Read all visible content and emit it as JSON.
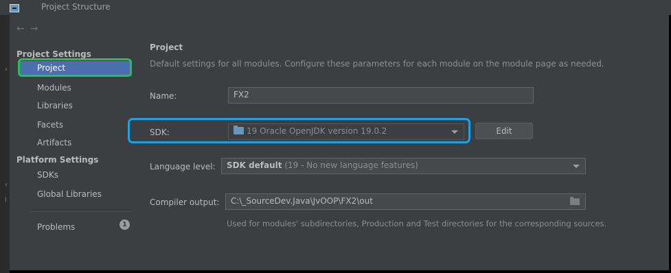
{
  "window": {
    "title": "Project Structure"
  },
  "nav": {
    "back": "←",
    "forward": "→"
  },
  "sidebar": {
    "project_settings_header": "Project Settings",
    "project_settings_items": [
      {
        "label": "Project",
        "selected": true
      },
      {
        "label": "Modules"
      },
      {
        "label": "Libraries"
      },
      {
        "label": "Facets"
      },
      {
        "label": "Artifacts"
      }
    ],
    "platform_settings_header": "Platform Settings",
    "platform_settings_items": [
      {
        "label": "SDKs"
      },
      {
        "label": "Global Libraries"
      }
    ],
    "problems": {
      "label": "Problems",
      "count": "1"
    }
  },
  "main": {
    "title": "Project",
    "description": "Default settings for all modules. Configure these parameters for each module on the module page as needed.",
    "name": {
      "label": "Name:",
      "value": "FX2"
    },
    "sdk": {
      "label": "SDK:",
      "version": "19",
      "detail": "Oracle OpenJDK version 19.0.2",
      "edit_label": "Edit"
    },
    "language_level": {
      "label": "Language level:",
      "bold": "SDK default",
      "detail": "(19 - No new language features)"
    },
    "compiler_output": {
      "label": "Compiler output:",
      "value": "C:\\_SourceDev.Java\\JvOOP\\FX2\\out",
      "hint": "Used for modules' subdirectories, Production and Test directories for the corresponding sources."
    }
  },
  "colors": {
    "selection": "#4b6eaf",
    "highlight_green": "#1ec454",
    "highlight_blue": "#1ba2e6",
    "panel_bg": "#3c3f41"
  }
}
